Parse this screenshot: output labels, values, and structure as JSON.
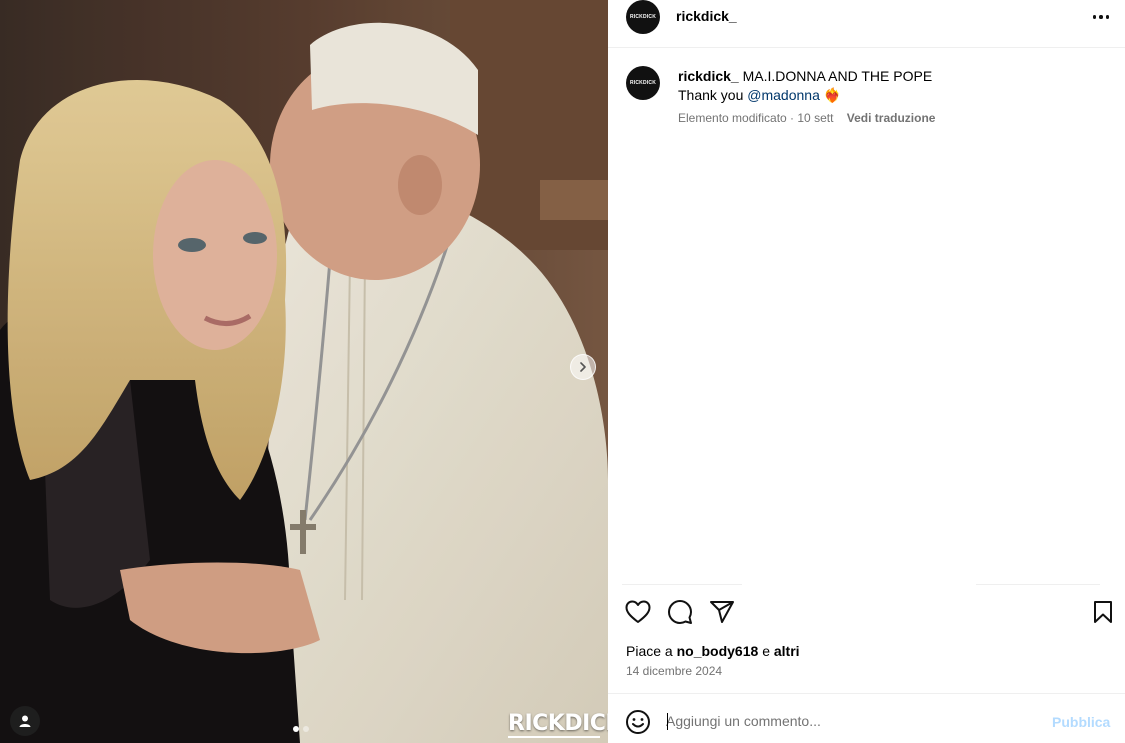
{
  "media": {
    "watermark": "RICKDICK",
    "carousel_dots": 2,
    "active_dot": 0
  },
  "post": {
    "username": "rickdick_",
    "avatar_text": "RICKDICK"
  },
  "caption": {
    "author": "rickdick_",
    "text": "MA.I.DONNA AND THE POPE",
    "line2_prefix": "Thank you",
    "mention": "@madonna",
    "emoji": "❤️‍🔥",
    "meta": "Elemento modificato · 10 sett",
    "translate_label": "Vedi traduzione"
  },
  "likes": {
    "prefix": "Piace a",
    "user": "no_body618",
    "joiner": "e",
    "others": "altri"
  },
  "date": "14 dicembre 2024",
  "comment": {
    "placeholder": "Aggiungi un commento...",
    "publish_label": "Pubblica"
  },
  "colors": {
    "mention": "#00376b",
    "secondary_text": "#737373",
    "publish_disabled": "#b3dbff",
    "divider": "#efefef"
  }
}
